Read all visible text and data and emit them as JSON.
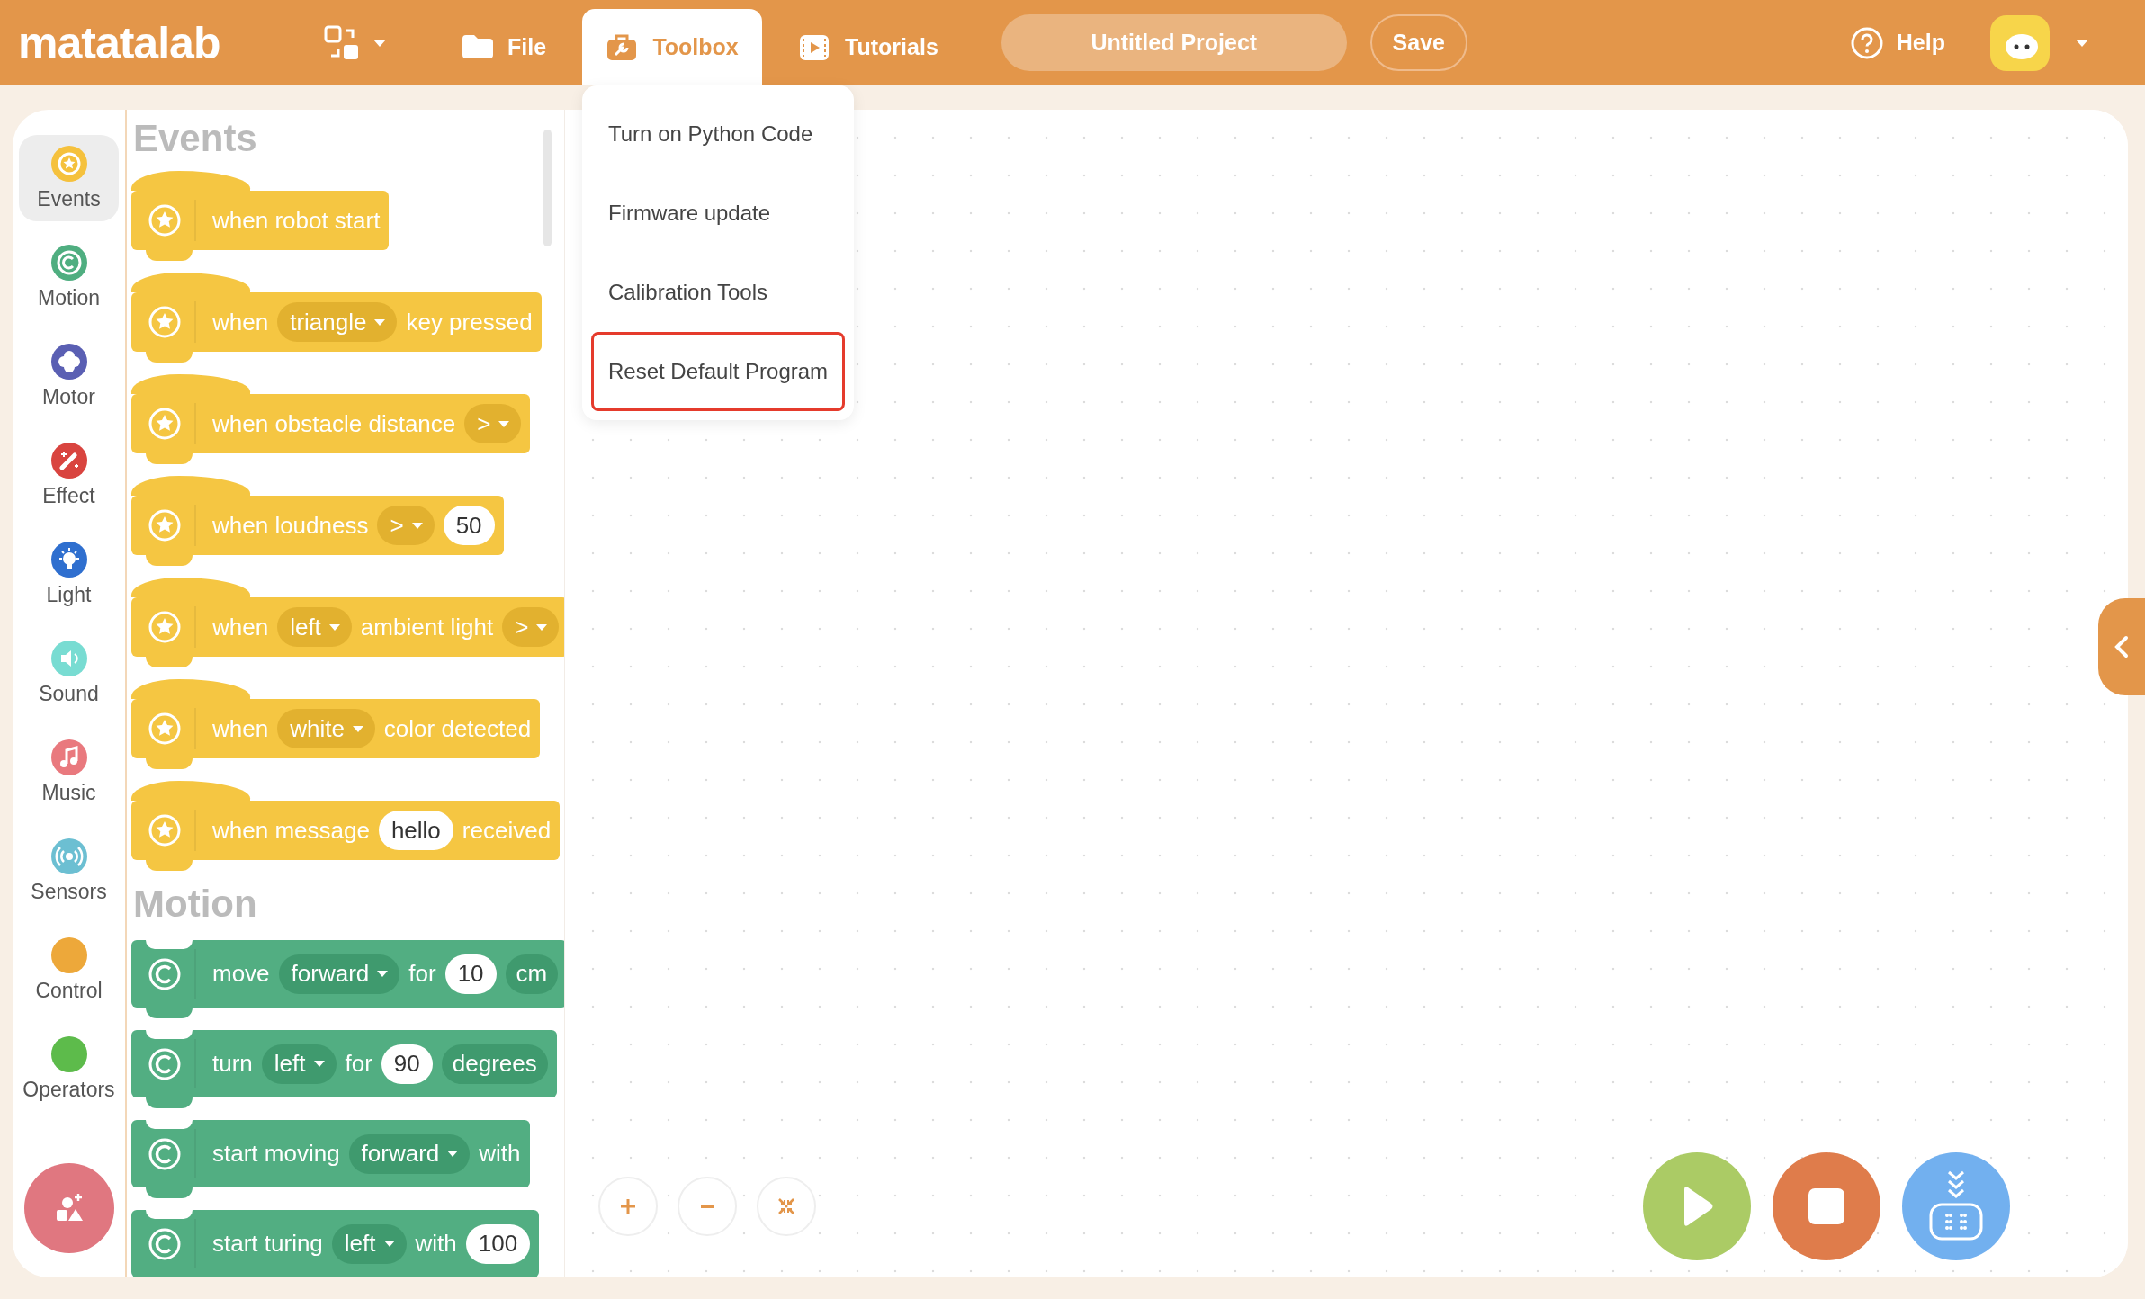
{
  "top_bar": {
    "logo": "matatalab",
    "nav": [
      {
        "kind": "file",
        "label": "File",
        "selected": false
      },
      {
        "kind": "toolbox",
        "label": "Toolbox",
        "selected": true
      },
      {
        "kind": "tutorials",
        "label": "Tutorials",
        "selected": false
      }
    ],
    "project_title": "Untitled Project",
    "save": "Save",
    "help": "Help"
  },
  "toolbox_menu": [
    {
      "label": "Turn on Python Code",
      "highlighted": false
    },
    {
      "label": "Firmware update",
      "highlighted": false
    },
    {
      "label": "Calibration Tools",
      "highlighted": false
    },
    {
      "label": "Reset Default Program",
      "highlighted": true
    }
  ],
  "categories": [
    {
      "kind": "events",
      "label": "Events",
      "color": "#f5c13d",
      "selected": true
    },
    {
      "kind": "motion",
      "label": "Motion",
      "color": "#4fae80",
      "selected": false
    },
    {
      "kind": "motor",
      "label": "Motor",
      "color": "#5a5fb3",
      "selected": false
    },
    {
      "kind": "effect",
      "label": "Effect",
      "color": "#d9443f",
      "selected": false
    },
    {
      "kind": "light",
      "label": "Light",
      "color": "#2f6fcf",
      "selected": false
    },
    {
      "kind": "sound",
      "label": "Sound",
      "color": "#78dcd2",
      "selected": false
    },
    {
      "kind": "music",
      "label": "Music",
      "color": "#e9797e",
      "selected": false
    },
    {
      "kind": "sensors",
      "label": "Sensors",
      "color": "#6cbfd2",
      "selected": false
    },
    {
      "kind": "control",
      "label": "Control",
      "color": "#eda83a",
      "selected": false
    },
    {
      "kind": "operators",
      "label": "Operators",
      "color": "#5dbb4b",
      "selected": false
    }
  ],
  "palette": [
    {
      "title": "Events",
      "kind": "event",
      "blocks": [
        {
          "parts": [
            {
              "kind": "text",
              "text": "when robot start"
            }
          ]
        },
        {
          "parts": [
            {
              "kind": "text",
              "text": "when"
            },
            {
              "kind": "dropdown",
              "text": "triangle"
            },
            {
              "kind": "text",
              "text": "key pressed"
            }
          ]
        },
        {
          "parts": [
            {
              "kind": "text",
              "text": "when obstacle distance"
            },
            {
              "kind": "dropdown",
              "text": ">"
            }
          ]
        },
        {
          "parts": [
            {
              "kind": "text",
              "text": "when loudness"
            },
            {
              "kind": "dropdown",
              "text": ">"
            },
            {
              "kind": "input",
              "text": "50"
            }
          ]
        },
        {
          "parts": [
            {
              "kind": "text",
              "text": "when"
            },
            {
              "kind": "dropdown",
              "text": "left"
            },
            {
              "kind": "text",
              "text": "ambient light"
            },
            {
              "kind": "dropdown",
              "text": ">"
            }
          ]
        },
        {
          "parts": [
            {
              "kind": "text",
              "text": "when"
            },
            {
              "kind": "dropdown",
              "text": "white"
            },
            {
              "kind": "text",
              "text": "color detected"
            }
          ]
        },
        {
          "parts": [
            {
              "kind": "text",
              "text": "when message"
            },
            {
              "kind": "input",
              "text": "hello"
            },
            {
              "kind": "text",
              "text": "received"
            }
          ]
        }
      ]
    },
    {
      "title": "Motion",
      "kind": "motion",
      "blocks": [
        {
          "parts": [
            {
              "kind": "text",
              "text": "move"
            },
            {
              "kind": "dropdown",
              "text": "forward"
            },
            {
              "kind": "text",
              "text": "for"
            },
            {
              "kind": "input",
              "text": "10"
            },
            {
              "kind": "pill",
              "text": "cm"
            }
          ]
        },
        {
          "parts": [
            {
              "kind": "text",
              "text": "turn"
            },
            {
              "kind": "dropdown",
              "text": "left"
            },
            {
              "kind": "text",
              "text": "for"
            },
            {
              "kind": "input",
              "text": "90"
            },
            {
              "kind": "pill",
              "text": "degrees"
            }
          ]
        },
        {
          "parts": [
            {
              "kind": "text",
              "text": "start moving"
            },
            {
              "kind": "dropdown",
              "text": "forward"
            },
            {
              "kind": "text",
              "text": "with"
            }
          ]
        },
        {
          "parts": [
            {
              "kind": "text",
              "text": "start turing"
            },
            {
              "kind": "dropdown",
              "text": "left"
            },
            {
              "kind": "text",
              "text": "with"
            },
            {
              "kind": "input",
              "text": "100"
            }
          ]
        }
      ]
    }
  ]
}
